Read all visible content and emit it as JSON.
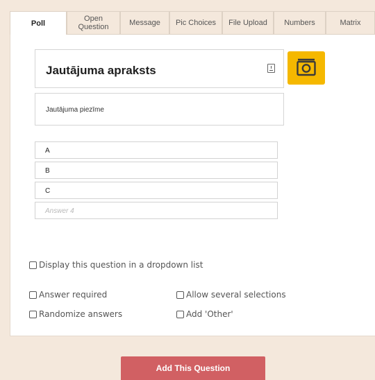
{
  "tabs": [
    {
      "label": "Poll"
    },
    {
      "label": "Open Question"
    },
    {
      "label": "Message"
    },
    {
      "label": "Pic Choices"
    },
    {
      "label": "File Upload"
    },
    {
      "label": "Numbers"
    },
    {
      "label": "Matrix"
    }
  ],
  "question": {
    "title": "Jautājuma apraksts",
    "note": "Jautājuma piezīme"
  },
  "answers": [
    {
      "value": "A"
    },
    {
      "value": "B"
    },
    {
      "value": "C"
    },
    {
      "placeholder": "Answer 4"
    }
  ],
  "options": {
    "dropdown": "Display this question in a dropdown list",
    "required": "Answer required",
    "several": "Allow several selections",
    "randomize": "Randomize answers",
    "other": "Add 'Other'"
  },
  "submit_label": "Add This Question",
  "colors": {
    "camera_button": "#f5b800",
    "submit_button": "#d16063",
    "background": "#f4e8dc"
  },
  "icons": {
    "camera": "camera-icon",
    "note": "note-icon"
  }
}
